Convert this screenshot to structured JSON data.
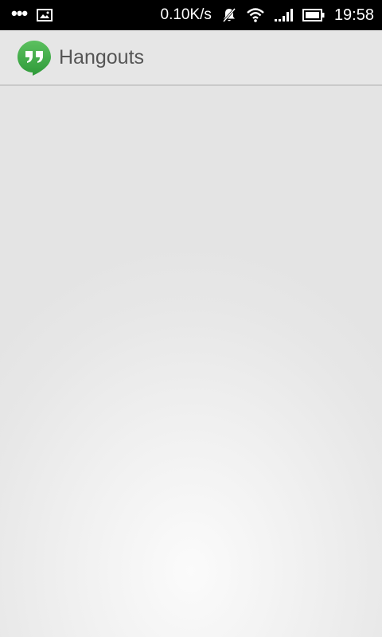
{
  "status_bar": {
    "menu_icon": "overflow-dots-icon",
    "notification_icon": "image-icon",
    "network_speed": "0.10K/s",
    "silent_icon": "notifications-off-icon",
    "wifi_icon": "wifi-icon",
    "signal_icon": "signal-icon",
    "battery_icon": "battery-icon",
    "time": "19:58"
  },
  "action_bar": {
    "app_icon": "hangouts-icon",
    "title": "Hangouts"
  },
  "colors": {
    "status_bar_bg": "#000000",
    "action_bar_bg": "#e6e6e6",
    "hangouts_green": "#4caf50",
    "title_text": "#555555"
  }
}
